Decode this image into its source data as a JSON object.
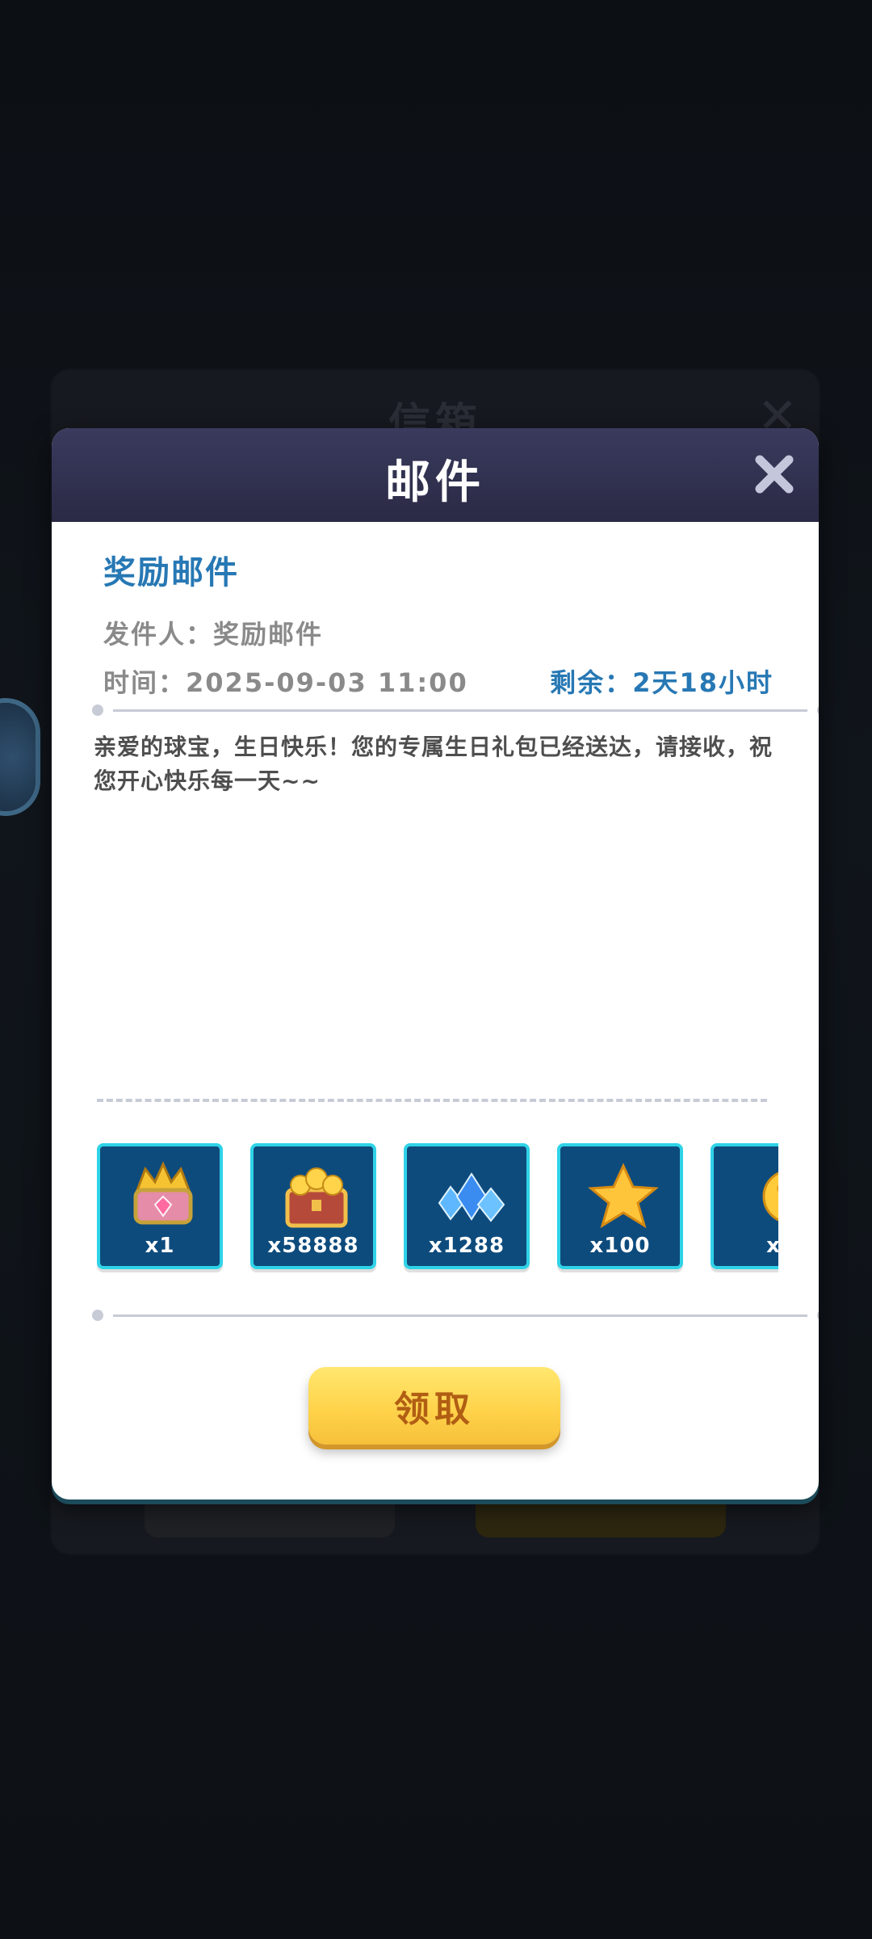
{
  "background_panel": {
    "title": "信箱"
  },
  "dialog": {
    "title": "邮件",
    "subject": "奖励邮件",
    "sender_label": "发件人：",
    "sender_value": "奖励邮件",
    "time_label": "时间：",
    "time_value": "2025-09-03 11:00",
    "remain_label": "剩余：",
    "remain_value": "2天18小时",
    "body": "亲爱的球宝，生日快乐！您的专属生日礼包已经送达，请接收，祝您开心快乐每一天~~",
    "rewards": [
      {
        "icon": "golden-crown-chest-icon",
        "qty": "x1"
      },
      {
        "icon": "gold-coin-chest-icon",
        "qty": "x58888"
      },
      {
        "icon": "blue-diamonds-icon",
        "qty": "x1288"
      },
      {
        "icon": "gold-star-icon",
        "qty": "x100"
      },
      {
        "icon": "gold-ball-icon",
        "qty": "x"
      }
    ],
    "claim_label": "领取"
  },
  "colors": {
    "header": "#2f2f4f",
    "accent_blue": "#2778b4",
    "reward_bg": "#0e4b7d",
    "reward_border": "#2fd3e7",
    "button_yellow": "#ffd34b",
    "button_text": "#b15e14"
  }
}
